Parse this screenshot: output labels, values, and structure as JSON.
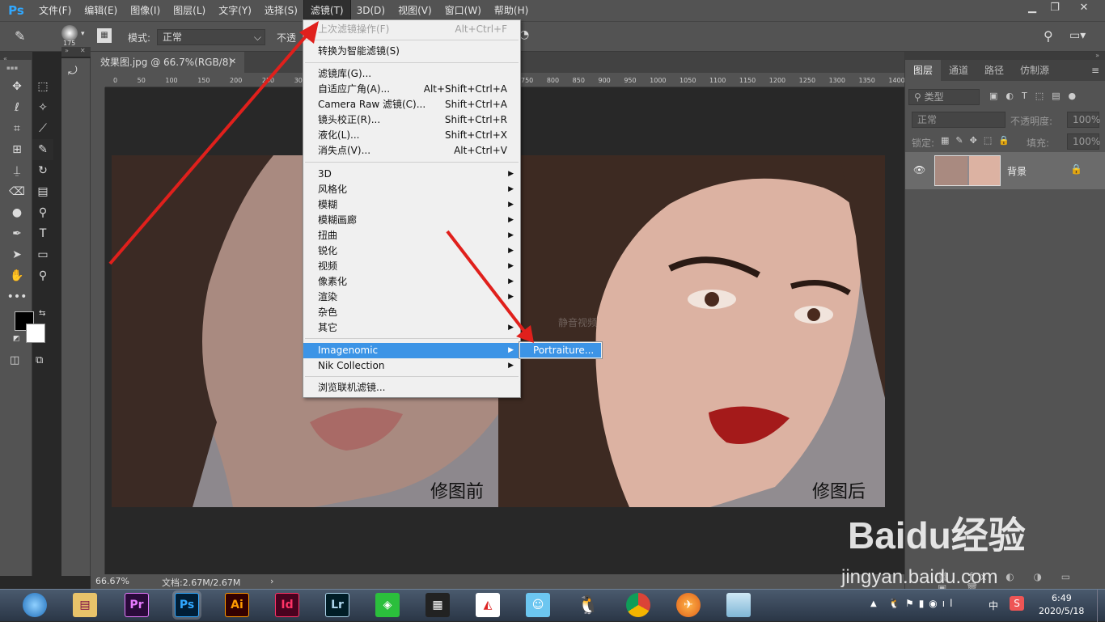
{
  "app": {
    "logo": "Ps"
  },
  "menubar": {
    "items": [
      "文件(F)",
      "编辑(E)",
      "图像(I)",
      "图层(L)",
      "文字(Y)",
      "选择(S)",
      "滤镜(T)",
      "3D(D)",
      "视图(V)",
      "窗口(W)",
      "帮助(H)"
    ],
    "active_index": 6
  },
  "optbar": {
    "brush_size": "175",
    "mode_label": "模式:",
    "mode_value": "正常",
    "opacity_label": "不透"
  },
  "document": {
    "tab_title": "效果图.jpg @ 66.7%(RGB/8)",
    "ruler_left": [
      "0",
      "50",
      "100",
      "150",
      "200",
      "250",
      "300"
    ],
    "ruler_right": [
      "750",
      "800",
      "850",
      "900",
      "950",
      "1000",
      "1050",
      "1100",
      "1150",
      "1200",
      "1250",
      "1300",
      "1350",
      "1400"
    ],
    "before_label": "修图前",
    "after_label": "修图后",
    "watermark": "静音视频",
    "zoom": "66.67%",
    "doc_info": "文档:2.67M/2.67M"
  },
  "filter_menu": {
    "last_filter": {
      "label": "上次滤镜操作(F)",
      "shortcut": "Alt+Ctrl+F"
    },
    "smart": "转换为智能滤镜(S)",
    "group1": [
      {
        "label": "滤镜库(G)...",
        "shortcut": ""
      },
      {
        "label": "自适应广角(A)...",
        "shortcut": "Alt+Shift+Ctrl+A"
      },
      {
        "label": "Camera Raw 滤镜(C)...",
        "shortcut": "Shift+Ctrl+A"
      },
      {
        "label": "镜头校正(R)...",
        "shortcut": "Shift+Ctrl+R"
      },
      {
        "label": "液化(L)...",
        "shortcut": "Shift+Ctrl+X"
      },
      {
        "label": "消失点(V)...",
        "shortcut": "Alt+Ctrl+V"
      }
    ],
    "group2": [
      "3D",
      "风格化",
      "模糊",
      "模糊画廊",
      "扭曲",
      "锐化",
      "视频",
      "像素化",
      "渲染",
      "杂色",
      "其它"
    ],
    "group2_arrows": [
      true,
      true,
      true,
      true,
      true,
      true,
      true,
      true,
      true,
      false,
      true
    ],
    "plugins": [
      "Imagenomic",
      "Nik Collection"
    ],
    "browse": "浏览联机滤镜...",
    "submenu_item": "Portraiture..."
  },
  "layers_panel": {
    "tabs": [
      "图层",
      "通道",
      "路径",
      "仿制源"
    ],
    "kind_filter": "类型",
    "blend": "正常",
    "opacity_label": "不透明度:",
    "opacity": "100%",
    "lock_label": "锁定:",
    "fill_label": "填充:",
    "fill": "100%",
    "layer_name": "背景"
  },
  "taskbar": {
    "apps": [
      "Pr",
      "Ps",
      "Ai",
      "Id",
      "Lr"
    ],
    "time": "6:49",
    "date": "2020/5/18",
    "ime": "中"
  },
  "overlay": {
    "brand": "Baidu经验",
    "url": "jingyan.baidu.com"
  },
  "colors": {
    "accent": "#31a8ff",
    "menu_highlight": "#3c94e6",
    "arrow": "#e0201c"
  }
}
